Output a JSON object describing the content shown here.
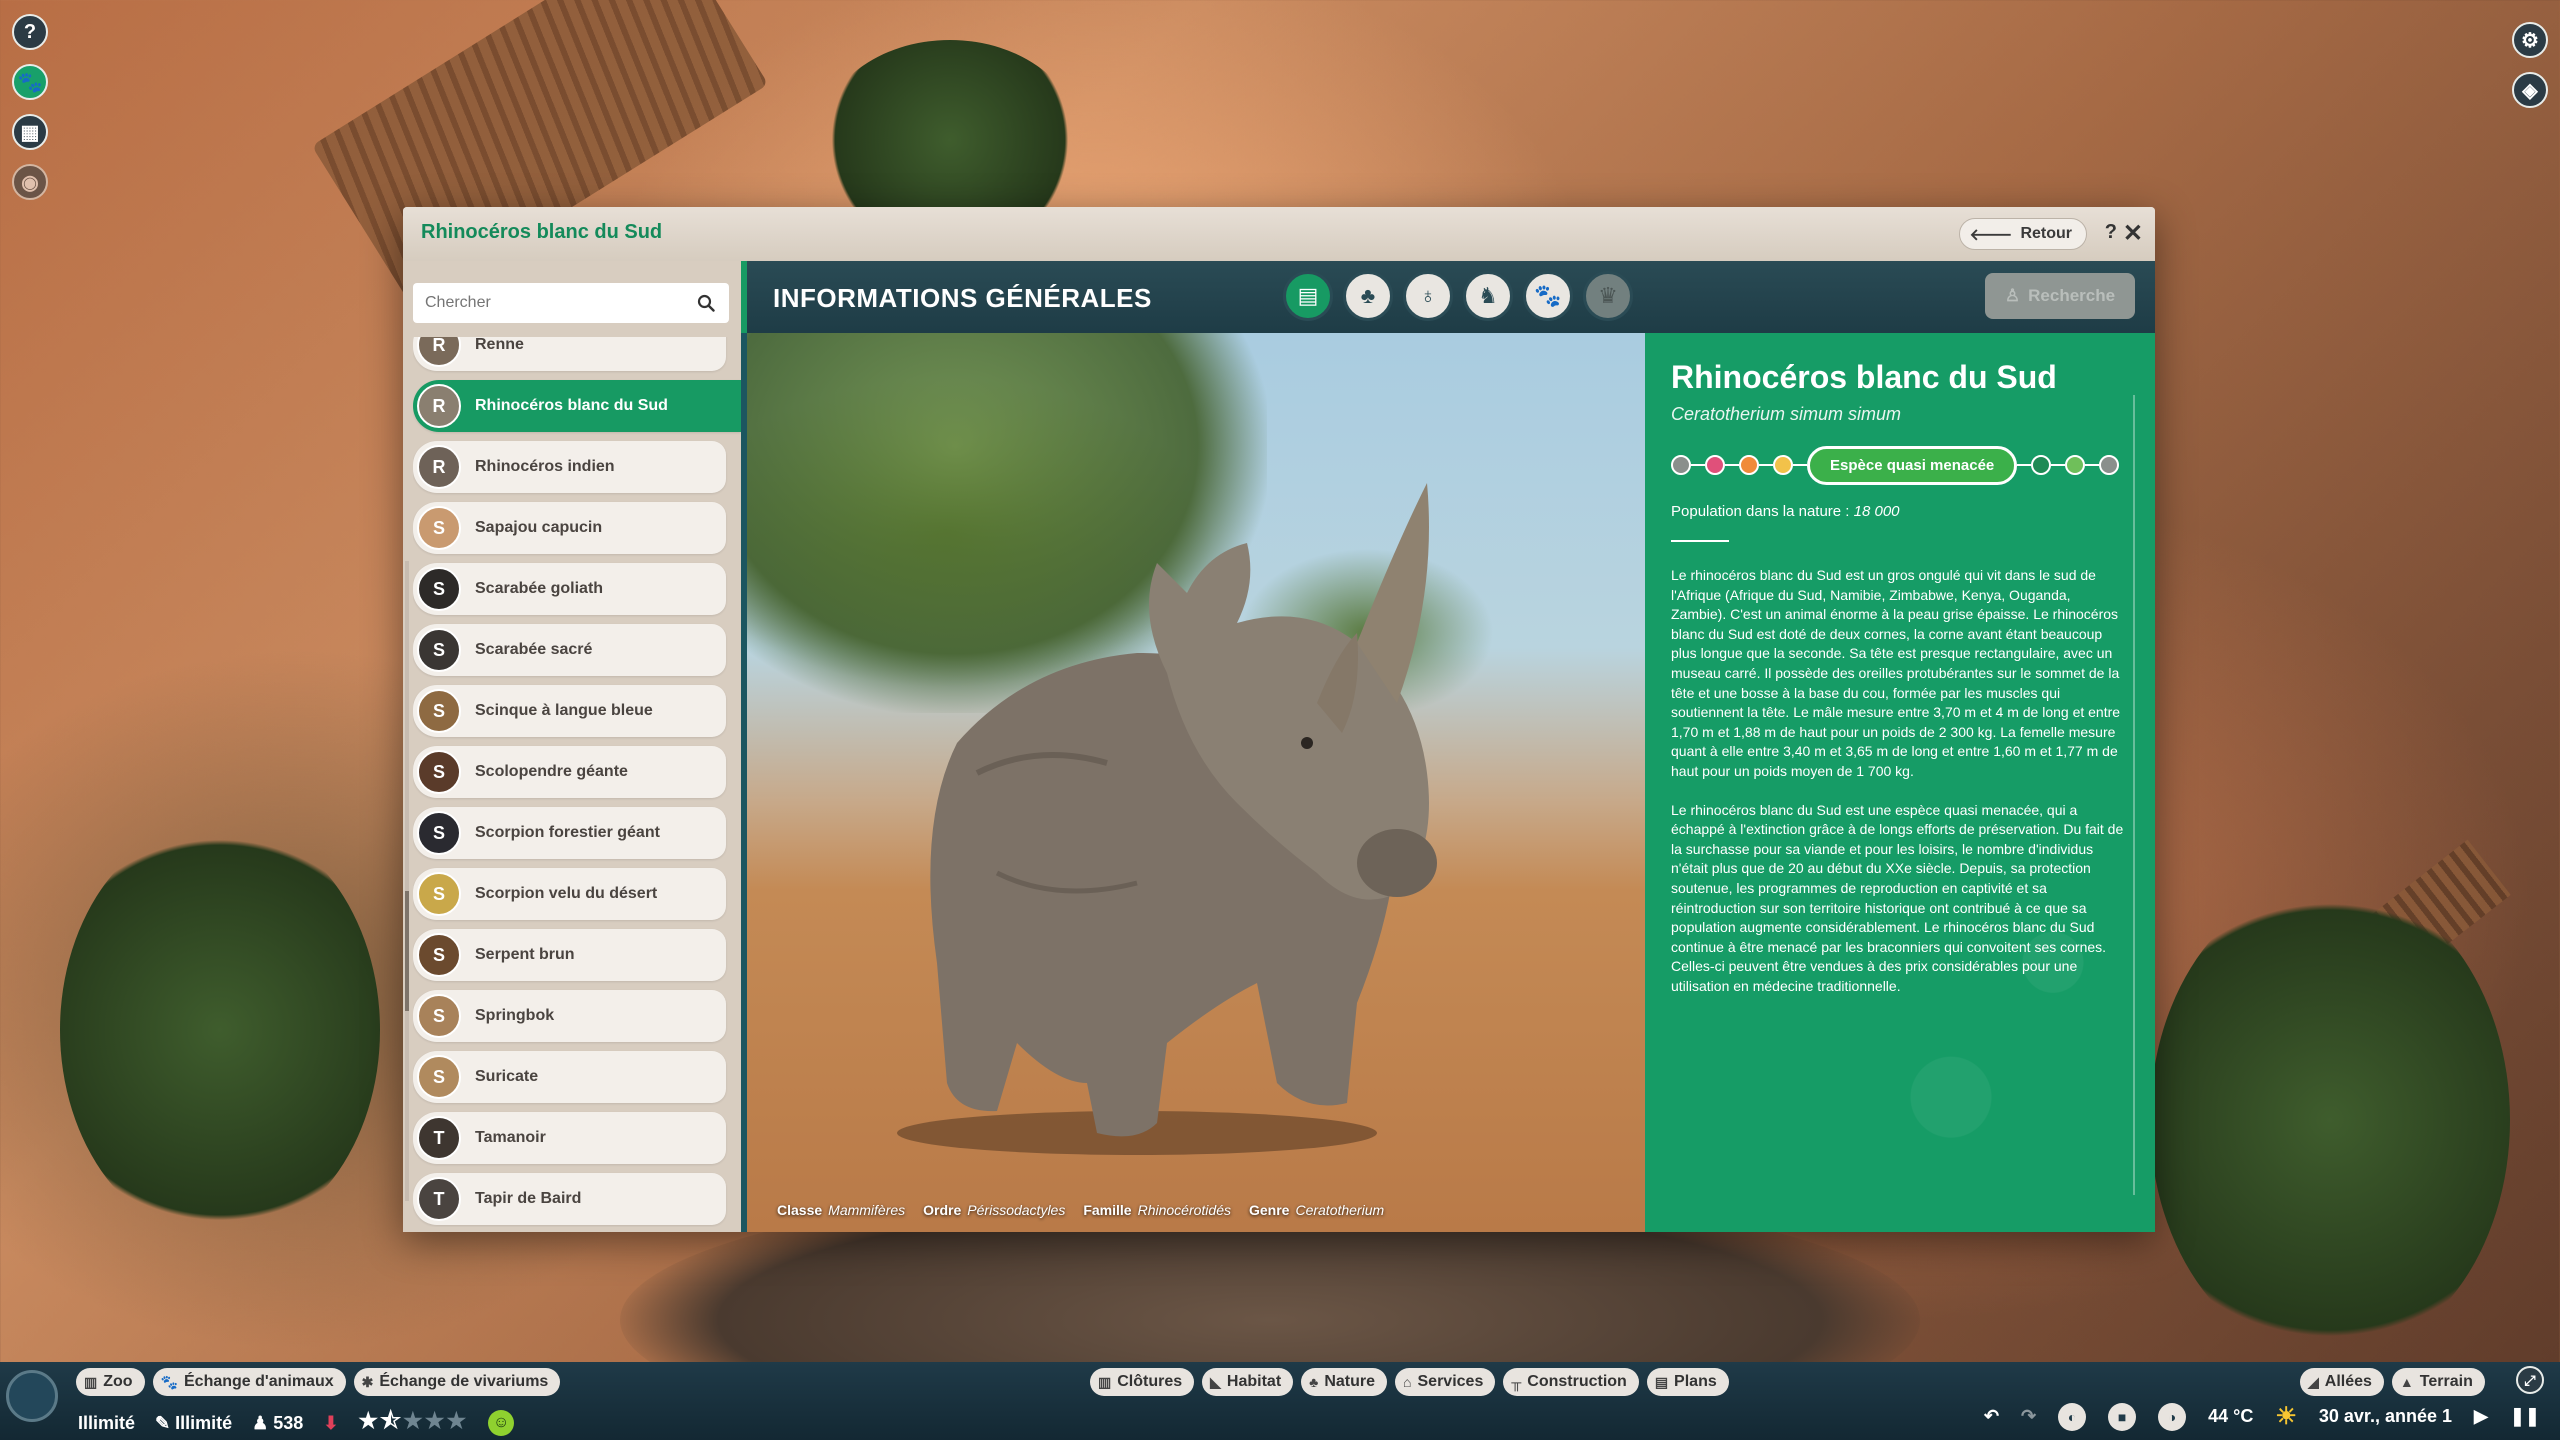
{
  "window": {
    "title": "Rhinocéros blanc du Sud",
    "back_label": "Retour",
    "help_label": "?",
    "close_label": "✕"
  },
  "left_toolbar": [
    {
      "icon": "help-icon",
      "glyph": "?"
    },
    {
      "icon": "paw-icon",
      "glyph": "🐾"
    },
    {
      "icon": "calendar-icon",
      "glyph": "▦"
    },
    {
      "icon": "eye-icon",
      "glyph": "◉"
    }
  ],
  "right_toolbar": [
    {
      "icon": "settings-icon",
      "glyph": "⚙"
    },
    {
      "icon": "camera-icon",
      "glyph": "◈"
    }
  ],
  "sidebar": {
    "search_placeholder": "Chercher",
    "items": [
      {
        "label": "Renne",
        "glyph": "R",
        "color": "#7a6a5a"
      },
      {
        "label": "Rhinocéros blanc du Sud",
        "glyph": "R",
        "color": "#8a7f70",
        "selected": true
      },
      {
        "label": "Rhinocéros indien",
        "glyph": "R",
        "color": "#6e6258"
      },
      {
        "label": "Sapajou capucin",
        "glyph": "S",
        "color": "#c99a70"
      },
      {
        "label": "Scarabée goliath",
        "glyph": "S",
        "color": "#2d2a28"
      },
      {
        "label": "Scarabée sacré",
        "glyph": "S",
        "color": "#3a3633"
      },
      {
        "label": "Scinque à langue bleue",
        "glyph": "S",
        "color": "#8e6a42"
      },
      {
        "label": "Scolopendre géante",
        "glyph": "S",
        "color": "#5a3b2a"
      },
      {
        "label": "Scorpion forestier géant",
        "glyph": "S",
        "color": "#2a2a30"
      },
      {
        "label": "Scorpion velu du désert",
        "glyph": "S",
        "color": "#c9a84a"
      },
      {
        "label": "Serpent brun",
        "glyph": "S",
        "color": "#6b4a2e"
      },
      {
        "label": "Springbok",
        "glyph": "S",
        "color": "#a8825a"
      },
      {
        "label": "Suricate",
        "glyph": "S",
        "color": "#b08a5e"
      },
      {
        "label": "Tamanoir",
        "glyph": "T",
        "color": "#3e3630"
      },
      {
        "label": "Tapir de Baird",
        "glyph": "T",
        "color": "#4a4440"
      }
    ]
  },
  "content": {
    "title": "INFORMATIONS GÉNÉRALES",
    "tabs": [
      {
        "icon": "clipboard-icon",
        "glyph": "▤",
        "active": true
      },
      {
        "icon": "habitat-icon",
        "glyph": "♣"
      },
      {
        "icon": "food-icon",
        "glyph": "♁"
      },
      {
        "icon": "group-icon",
        "glyph": "♞"
      },
      {
        "icon": "paw-icon",
        "glyph": "🐾"
      },
      {
        "icon": "trophy-icon",
        "glyph": "♛",
        "disabled": true
      }
    ],
    "research_label": "Recherche"
  },
  "photo_meta": {
    "classe_label": "Classe",
    "classe_value": "Mammifères",
    "ordre_label": "Ordre",
    "ordre_value": "Périssodactyles",
    "famille_label": "Famille",
    "famille_value": "Rhinocérotidés",
    "genre_label": "Genre",
    "genre_value": "Ceratotherium"
  },
  "info": {
    "name": "Rhinocéros blanc du Sud",
    "scientific_name": "Ceratotherium simum simum",
    "status_label": "Espèce quasi menacée",
    "status_dots_before": [
      "#8a8f8c",
      "#e0507a",
      "#f08a3a",
      "#f2c24a"
    ],
    "status_dots_after": [
      "#1f8a55",
      "#6fbf5a",
      "#8a8f8c"
    ],
    "population_label": "Population dans la nature :",
    "population_value": "18 000",
    "description_1": "Le rhinocéros blanc du Sud est un gros ongulé qui vit dans le sud de l'Afrique (Afrique du Sud, Namibie, Zimbabwe, Kenya, Ouganda, Zambie). C'est un animal énorme à la peau grise épaisse. Le rhinocéros blanc du Sud est doté de deux cornes, la corne avant étant beaucoup plus longue que la seconde. Sa tête est presque rectangulaire, avec un museau carré. Il possède des oreilles protubérantes sur le sommet de la tête et une bosse à la base du cou, formée par les muscles qui soutiennent la tête. Le mâle mesure entre 3,70 m et 4 m de long et entre 1,70 m et 1,88 m de haut pour un poids de 2 300 kg. La femelle mesure quant à elle entre 3,40 m et 3,65 m de long et entre 1,60 m et 1,77 m de haut pour un poids moyen de 1 700 kg.",
    "description_2": "Le rhinocéros blanc du Sud est une espèce quasi menacée, qui a échappé à l'extinction grâce à de longs efforts de préservation. Du fait de la surchasse pour sa viande et pour les loisirs, le nombre d'individus n'était plus que de 20 au début du XXe siècle. Depuis, sa protection soutenue, les programmes de reproduction en captivité et sa réintroduction sur son territoire historique ont contribué à ce que sa population augmente considérablement. Le rhinocéros blanc du Sud continue à être menacé par les braconniers qui convoitent ses cornes. Celles-ci peuvent être vendues à des prix considérables pour une utilisation en médecine traditionnelle."
  },
  "bottom_bar": {
    "left_nav": [
      {
        "label": "Zoo",
        "icon": "zoo-icon",
        "glyph": "▥"
      },
      {
        "label": "Échange d'animaux",
        "icon": "animal-exchange-icon",
        "glyph": "🐾"
      },
      {
        "label": "Échange de vivariums",
        "icon": "vivarium-exchange-icon",
        "glyph": "✱"
      }
    ],
    "center_nav": [
      {
        "label": "Clôtures",
        "icon": "fence-icon",
        "glyph": "▥"
      },
      {
        "label": "Habitat",
        "icon": "habitat-icon",
        "glyph": "◣"
      },
      {
        "label": "Nature",
        "icon": "nature-icon",
        "glyph": "♣"
      },
      {
        "label": "Services",
        "icon": "services-icon",
        "glyph": "⌂"
      },
      {
        "label": "Construction",
        "icon": "construction-icon",
        "glyph": "╥"
      },
      {
        "label": "Plans",
        "icon": "blueprint-icon",
        "glyph": "▤"
      }
    ],
    "right_nav": [
      {
        "label": "Allées",
        "icon": "path-icon",
        "glyph": "◢"
      },
      {
        "label": "Terrain",
        "icon": "terrain-icon",
        "glyph": "▲"
      }
    ],
    "money": "Illimité",
    "research": "Illimité",
    "guests": "538",
    "rating_stars": 1.5,
    "temperature": "44 °C",
    "date": "30 avr., année 1"
  }
}
